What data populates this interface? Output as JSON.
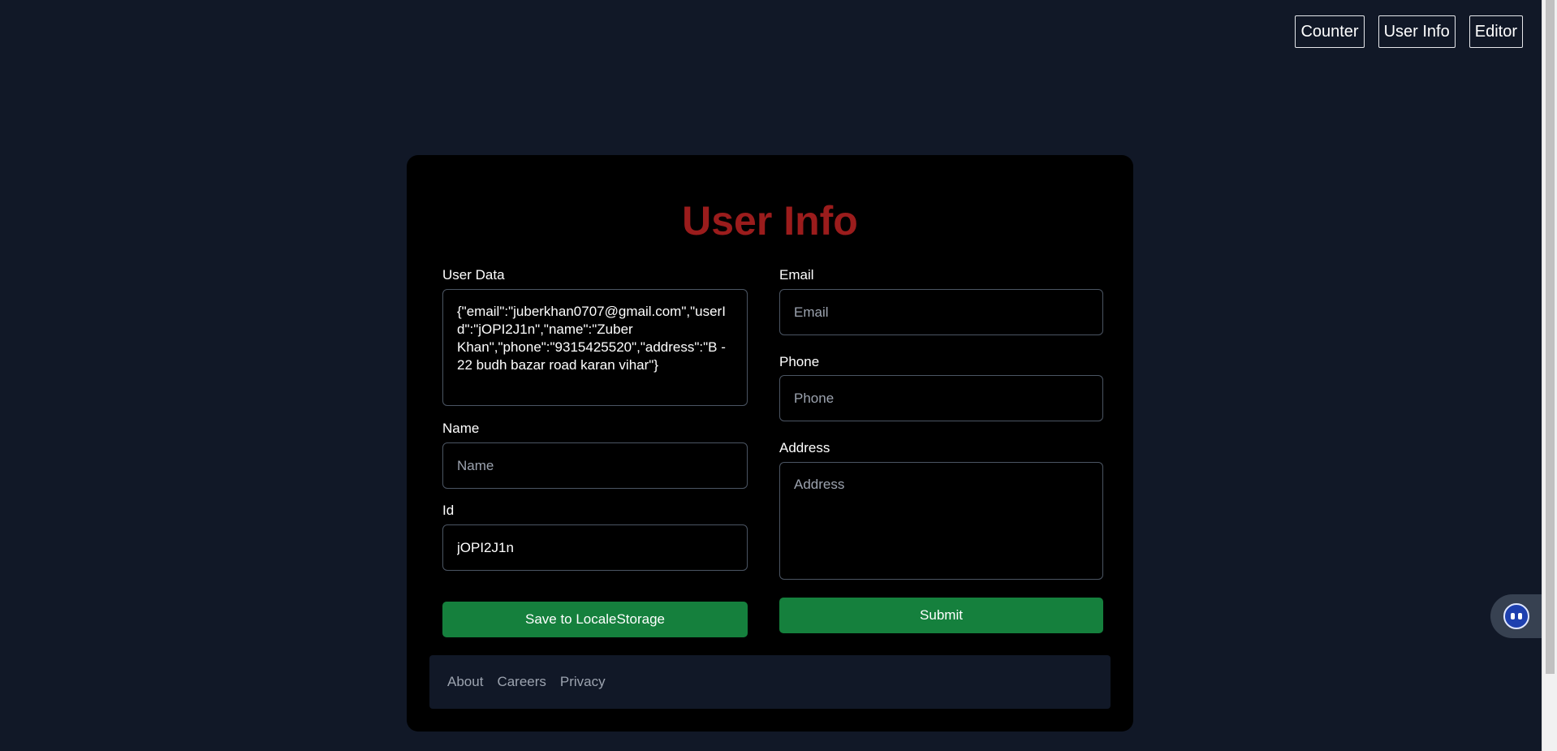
{
  "nav": {
    "counter": "Counter",
    "user_info": "User Info",
    "editor": "Editor"
  },
  "card": {
    "title": "User Info",
    "user_data": {
      "label": "User Data",
      "value": "{\"email\":\"juberkhan0707@gmail.com\",\"userId\":\"jOPI2J1n\",\"name\":\"Zuber Khan\",\"phone\":\"9315425520\",\"address\":\"B - 22 budh bazar road karan vihar\"}"
    },
    "name": {
      "label": "Name",
      "placeholder": "Name",
      "value": ""
    },
    "id": {
      "label": "Id",
      "value": "jOPI2J1n"
    },
    "save_button": "Save to LocaleStorage",
    "email": {
      "label": "Email",
      "placeholder": "Email"
    },
    "phone": {
      "label": "Phone",
      "placeholder": "Phone"
    },
    "address": {
      "label": "Address",
      "placeholder": "Address"
    },
    "submit_button": "Submit"
  },
  "footer": {
    "links": [
      "About",
      "Careers",
      "Privacy"
    ]
  },
  "colors": {
    "background": "#111827",
    "card": "#000000",
    "title": "#9b1c1c",
    "button": "#15803d"
  },
  "widget": {
    "icon": "assistant-bot-icon"
  }
}
